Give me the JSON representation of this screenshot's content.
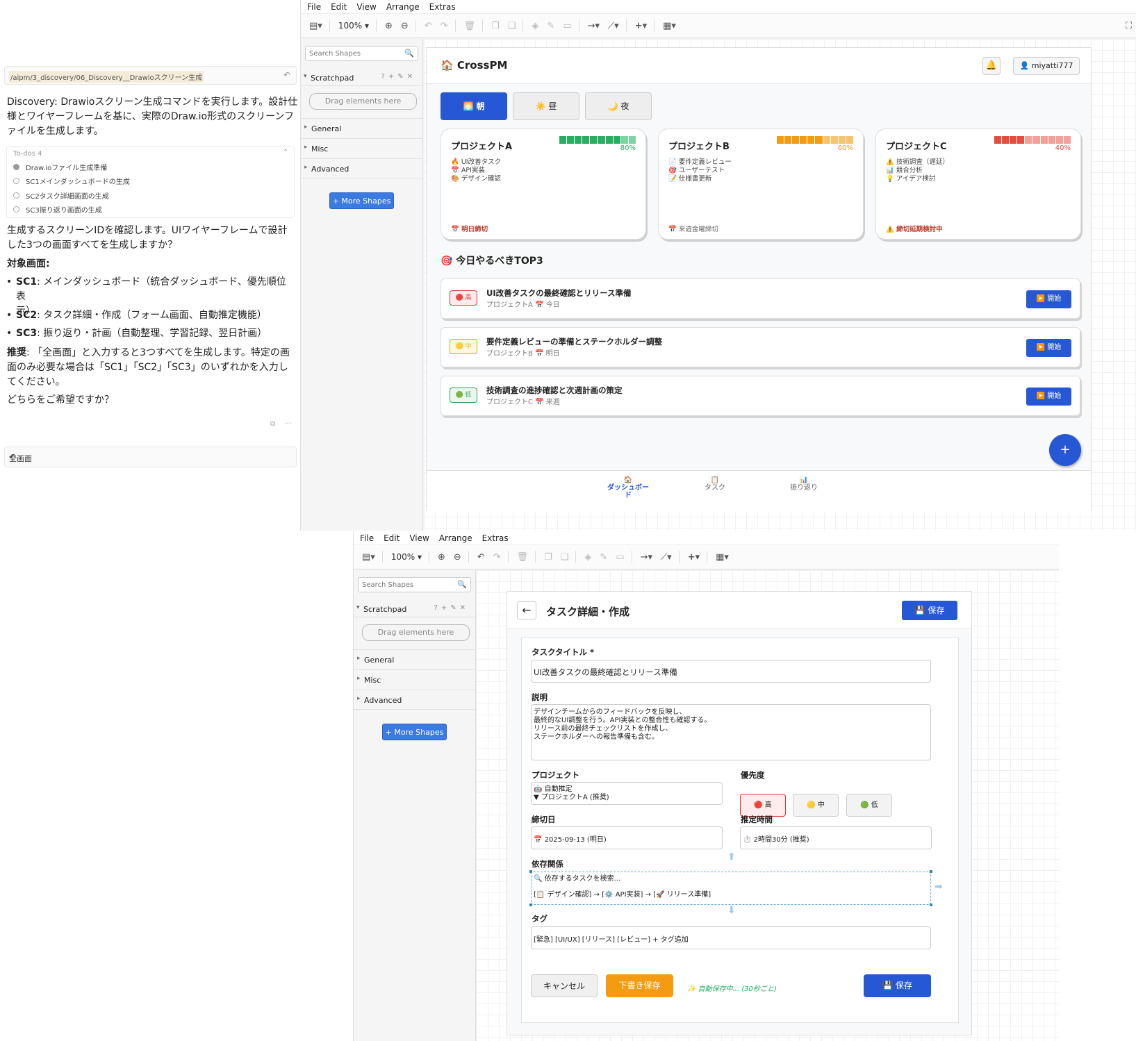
{
  "chat": {
    "command_path": "/aipm/3_discovery/06_Discovery__Drawioスクリーン生成",
    "intro_lines": [
      "Discovery: Drawioスクリーン生成コマンドを実行します。設計仕",
      "様とワイヤーフレームを基に、実際のDraw.io形式のスクリーンフ",
      "ァイルを生成します。"
    ],
    "todos_header": "To-dos  4",
    "todos": [
      {
        "label": "Draw.ioファイル生成準備",
        "done": true
      },
      {
        "label": "SC1メインダッシュボードの生成",
        "done": false
      },
      {
        "label": "SC2タスク詳細画面の生成",
        "done": false
      },
      {
        "label": "SC3振り返り画面の生成",
        "done": false
      }
    ],
    "question_lines": [
      "生成するスクリーンIDを確認します。UIワイヤーフレームで設計",
      "した3つの画面すべてを生成しますか？"
    ],
    "targets_heading": "対象画面:",
    "targets": [
      {
        "id": "SC1",
        "text": ": メインダッシュボード（統合ダッシュボード、優先順位表",
        "cont": "示）"
      },
      {
        "id": "SC2",
        "text": ": タスク詳細・作成（フォーム画面、自動推定機能）",
        "cont": ""
      },
      {
        "id": "SC3",
        "text": ": 振り返り・計画（自動整理、学習記録、翌日計画）",
        "cont": ""
      }
    ],
    "recommend_label": "推奨",
    "recommend_lines": [
      ": 「全画面」と入力すると3つすべてを生成します。特定の画",
      "面のみ必要な場合は「SC1」「SC2」「SC3」のいずれかを入力し",
      "てください。"
    ],
    "ask": "どちらをご希望ですか？",
    "input_value": "全画面"
  },
  "drawio": {
    "menu": [
      "File",
      "Edit",
      "View",
      "Arrange",
      "Extras"
    ],
    "zoom": "100%",
    "search_placeholder": "Search Shapes",
    "scratchpad": "Scratchpad",
    "drag_hint": "Drag elements here",
    "sections": [
      "General",
      "Misc",
      "Advanced"
    ],
    "more_shapes": "+ More Shapes"
  },
  "dashboard": {
    "app_name": "🏠 CrossPM",
    "bell": "🔔",
    "user": "👤 miyatti777",
    "time_tabs": [
      {
        "label": "🌅 朝",
        "active": true
      },
      {
        "label": "☀️ 昼",
        "active": false
      },
      {
        "label": "🌙 夜",
        "active": false
      }
    ],
    "projects": [
      {
        "name": "プロジェクトA",
        "progress": 80,
        "color": "#27ae60",
        "light": "#7fd3a3",
        "tasks": [
          "🔥 UI改善タスク",
          "📅 API実装",
          "🎨 デザイン確認"
        ],
        "due": "📅 明日締切",
        "due_color": "#c0392b"
      },
      {
        "name": "プロジェクトB",
        "progress": 60,
        "color": "#f39c12",
        "light": "#f6c36e",
        "tasks": [
          "📄 要件定義レビュー",
          "🎯 ユーザーテスト",
          "📝 仕様書更新"
        ],
        "due": "📅 来週金曜締切",
        "due_color": "#666666"
      },
      {
        "name": "プロジェクトC",
        "progress": 40,
        "color": "#e74c3c",
        "light": "#f3a099",
        "tasks": [
          "⚠️ 技術調査（遅延）",
          "📊 競合分析",
          "💡 アイデア検討"
        ],
        "due": "⚠️ 締切延期検討中",
        "due_color": "#c0392b"
      }
    ],
    "top3_title": "🎯 今日やるべきTOP3",
    "top3": [
      {
        "priority": "🔴 高",
        "pcolor": "#d9362b",
        "pbg": "#fdeceb",
        "title": "UI改善タスクの最終確認とリリース準備",
        "sub": "プロジェクトA 📅 今日",
        "action": "▶️ 開始"
      },
      {
        "priority": "🟡 中",
        "pcolor": "#e0a400",
        "pbg": "#fff8e1",
        "title": "要件定義レビューの準備とステークホルダー調整",
        "sub": "プロジェクトB 📅 明日",
        "action": "▶️ 開始"
      },
      {
        "priority": "🟢 低",
        "pcolor": "#2e9e4f",
        "pbg": "#eaf7ee",
        "title": "技術調査の進捗確認と次週計画の策定",
        "sub": "プロジェクトC 📅 来週",
        "action": "▶️ 開始"
      }
    ],
    "fab": "+",
    "nav": [
      {
        "icon": "🏠",
        "label": "ダッシュボード",
        "active": true
      },
      {
        "icon": "📋",
        "label": "タスク",
        "active": false
      },
      {
        "icon": "📊",
        "label": "振り返り",
        "active": false
      }
    ]
  },
  "taskform": {
    "back": "←",
    "title": "タスク詳細・作成",
    "save_top": "💾 保存",
    "title_label": "タスクタイトル *",
    "title_value": "UI改善タスクの最終確認とリリース準備",
    "desc_label": "説明",
    "desc_lines": [
      "デザインチームからのフィードバックを反映し、",
      "最終的なUI調整を行う。API実装との整合性も確認する。",
      "リリース前の最終チェックリストを作成し、",
      "ステークホルダーへの報告準備も含む。"
    ],
    "project_label": "プロジェクト",
    "project_line1": "🤖 自動推定",
    "project_line2": "▼ プロジェクトA (推奨)",
    "priority_label": "優先度",
    "priorities": [
      "🔴 高",
      "🟡 中",
      "🟢 低"
    ],
    "due_label": "締切日",
    "due_value": "📅 2025-09-13 (明日)",
    "est_label": "推定時間",
    "est_value": "⏱️ 2時間30分 (推奨)",
    "dep_label": "依存関係",
    "dep_search": "🔍 依存するタスクを検索...",
    "dep_chain": "[📋 デザイン確認] → [⚙️ API実装] → [🚀 リリース準備]",
    "tags_label": "タグ",
    "tags_value": "[緊急] [UI/UX] [リリース] [レビュー] + タグ追加",
    "cancel": "キャンセル",
    "draft": "下書き保存",
    "autosave": "✨ 自動保存中... (30秒ごと)",
    "save_bottom": "💾 保存"
  }
}
